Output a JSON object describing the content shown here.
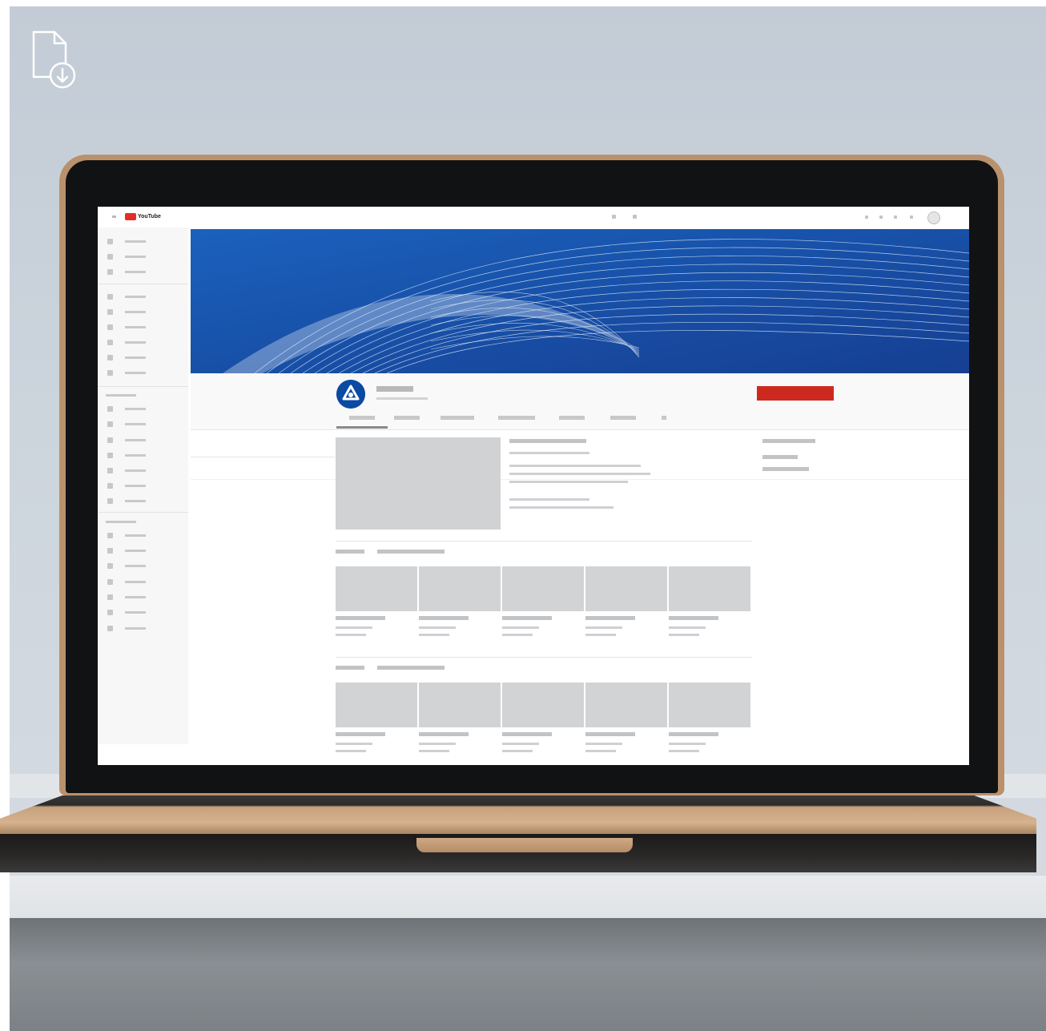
{
  "photo": {
    "subject": "laptop-mockup",
    "overlay_icon": "file-download-icon"
  },
  "screen": {
    "brand": "YouTube",
    "colors": {
      "banner": "#1f57ad",
      "subscribe": "#cc2a1f",
      "avatar": "#0b4aa3"
    }
  }
}
